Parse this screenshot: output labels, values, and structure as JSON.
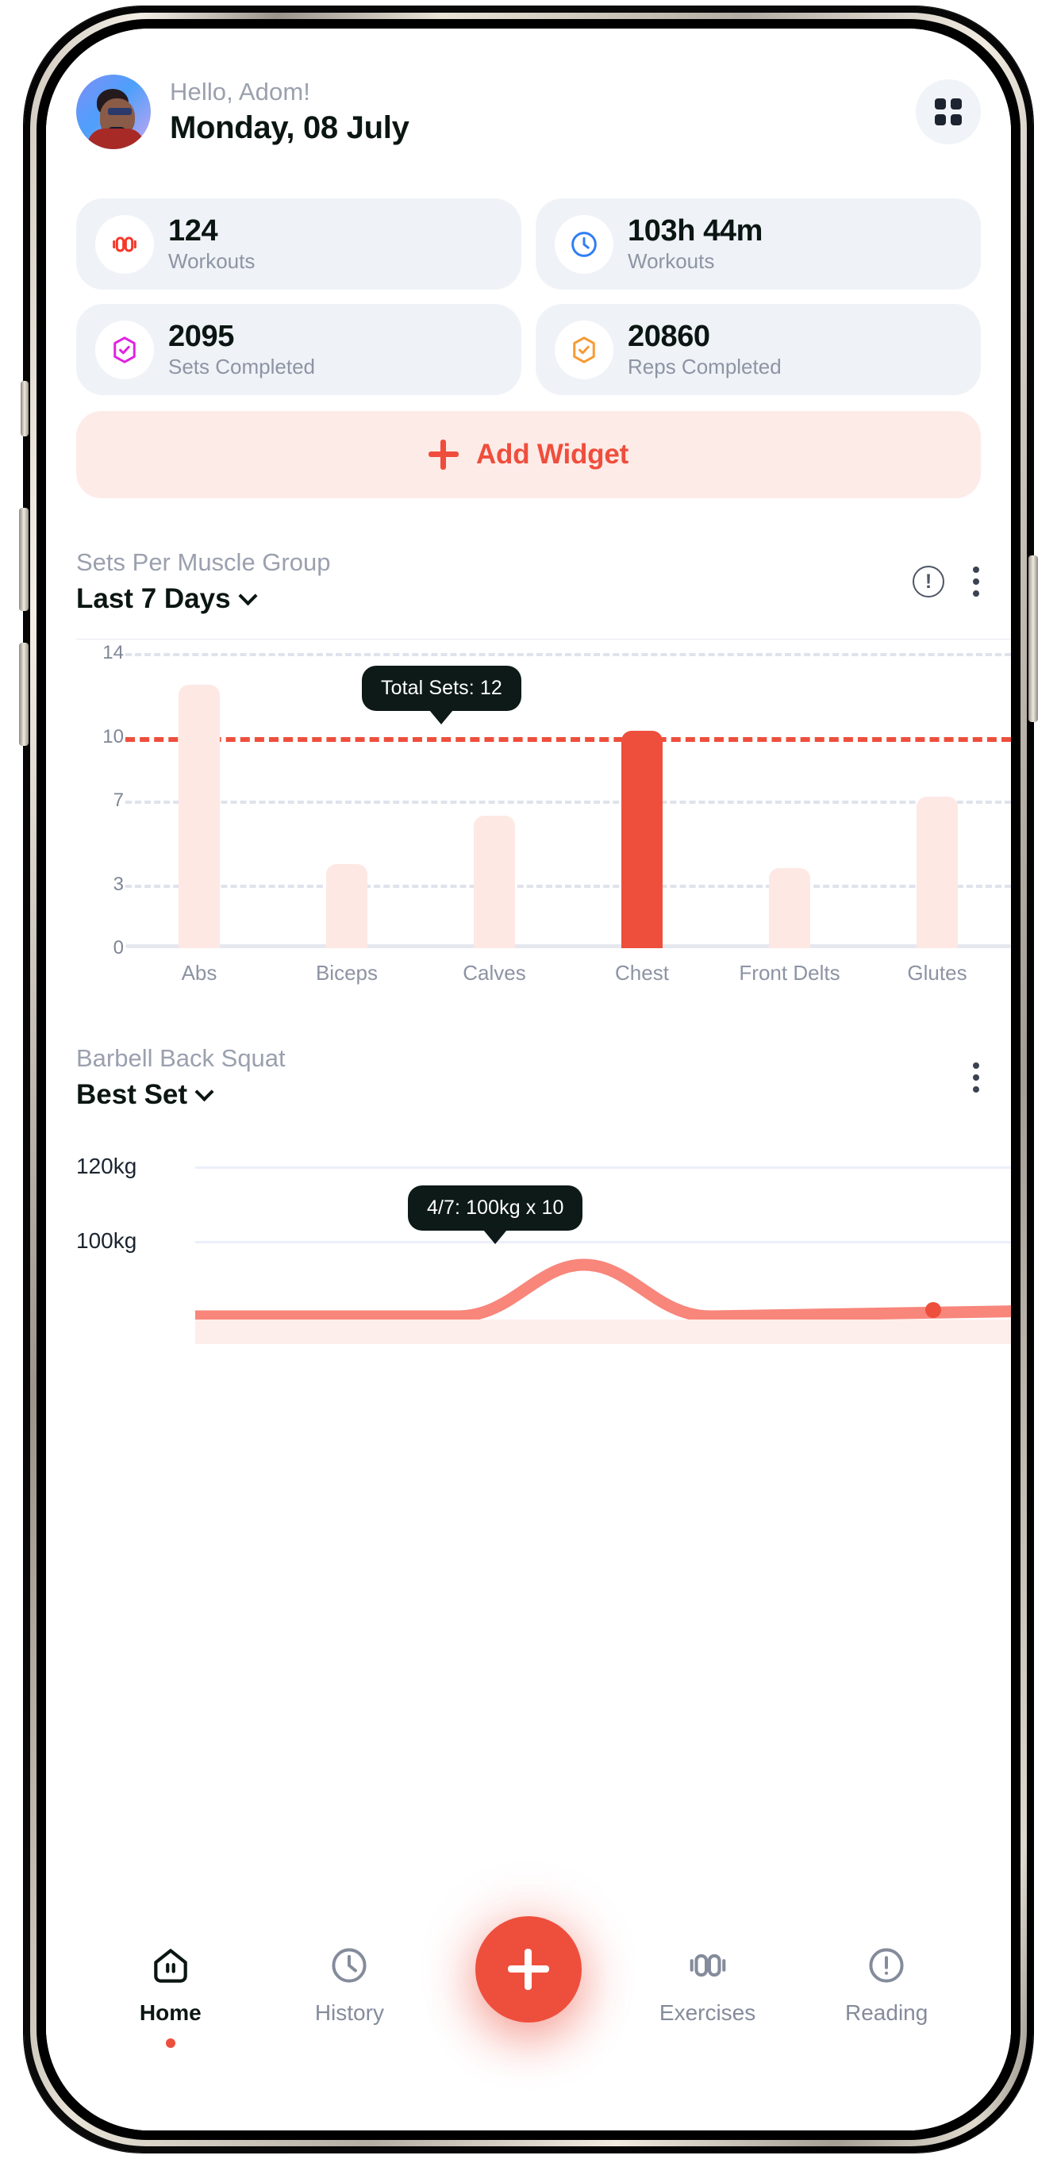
{
  "header": {
    "greeting": "Hello, Adom!",
    "date": "Monday, 08 July",
    "avatar_name": "user-avatar",
    "grid_button": "grid-menu-button"
  },
  "stats": [
    {
      "value": "124",
      "label": "Workouts",
      "icon": "dumbbell-icon",
      "color": "#f5372a"
    },
    {
      "value": "103h 44m",
      "label": "Workouts",
      "icon": "clock-icon",
      "color": "#2f7df5"
    },
    {
      "value": "2095",
      "label": "Sets Completed",
      "icon": "hexagon-check-icon",
      "color": "#e022e0"
    },
    {
      "value": "20860",
      "label": "Reps Completed",
      "icon": "hexagon-check-icon",
      "color": "#f79a32"
    }
  ],
  "add_widget": {
    "label": "Add Widget",
    "icon": "plus-icon",
    "accent": "#ef4e3c"
  },
  "widget_sets": {
    "title": "Sets Per Muscle Group",
    "range": "Last 7 Days",
    "info_icon": "info-circle-icon",
    "more_icon": "kebab-menu-icon",
    "tooltip": "Total Sets: 12"
  },
  "widget_squat": {
    "title": "Barbell Back Squat",
    "metric": "Best Set",
    "more_icon": "kebab-menu-icon",
    "tooltip": "4/7: 100kg x 10"
  },
  "bottom_nav": [
    {
      "label": "Home",
      "icon": "home-icon",
      "active": true
    },
    {
      "label": "History",
      "icon": "clock-icon",
      "active": false
    },
    {
      "label": "Exercises",
      "icon": "dumbbell-icon",
      "active": false
    },
    {
      "label": "Reading",
      "icon": "info-circle-icon",
      "active": false
    }
  ],
  "fab": {
    "icon": "plus-icon",
    "color": "#ee4f3d"
  },
  "chart_data": [
    {
      "type": "bar",
      "title": "Sets Per Muscle Group",
      "subtitle": "Last 7 Days",
      "xlabel": "",
      "ylabel": "",
      "categories": [
        "Abs",
        "Biceps",
        "Calves",
        "Chest",
        "Front Delts",
        "Glutes"
      ],
      "values": [
        12.5,
        4.0,
        6.3,
        10.3,
        3.8,
        7.2
      ],
      "highlight_index": 3,
      "highlight_color": "#ee4f3d",
      "bar_color": "#fde8e4",
      "ytick_labels": [
        "0",
        "3",
        "7",
        "10",
        "14"
      ],
      "yticks": [
        0,
        3,
        7,
        10,
        14
      ],
      "ylim": [
        0,
        14
      ],
      "grid": true,
      "target_line": {
        "value": 10,
        "color": "#ee4f3d",
        "style": "dashed"
      },
      "annotation": "Total Sets: 12",
      "legend": "none"
    },
    {
      "type": "line",
      "title": "Barbell Back Squat",
      "subtitle": "Best Set",
      "xlabel": "",
      "ylabel": "",
      "ytick_labels": [
        "100kg",
        "120kg"
      ],
      "yticks": [
        100,
        120
      ],
      "ylim": [
        80,
        130
      ],
      "grid": true,
      "line_color": "#f8867b",
      "point_color": "#ee4f3d",
      "annotation": "4/7: 100kg x 10",
      "points": [
        {
          "x": 0,
          "y": 80
        },
        {
          "x": 1,
          "y": 80
        },
        {
          "x": 2,
          "y": 100
        },
        {
          "x": 3,
          "y": 80
        },
        {
          "x": 4,
          "y": 82
        }
      ],
      "legend": "none"
    }
  ]
}
